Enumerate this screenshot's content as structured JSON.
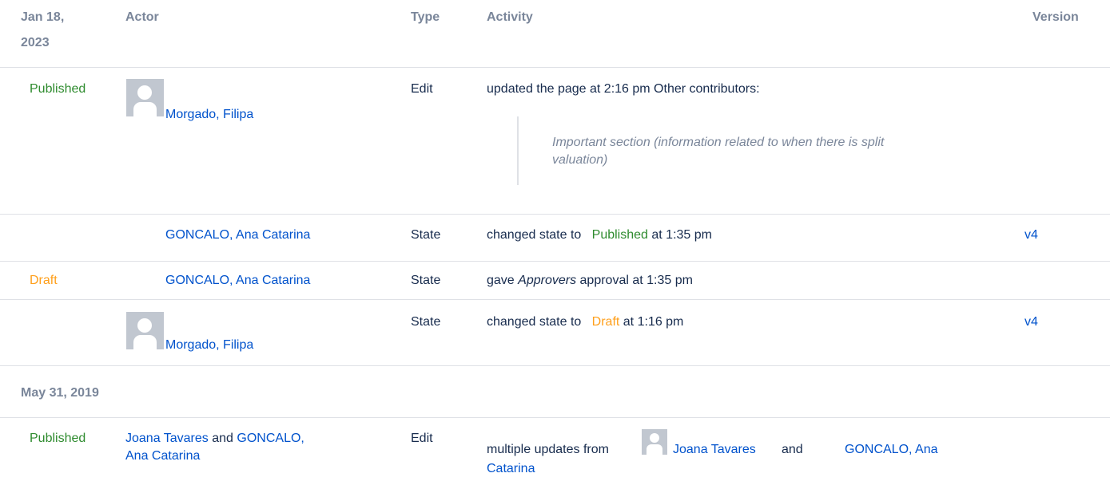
{
  "header": {
    "date": "Jan 18,",
    "date_year": "2023",
    "actor": "Actor",
    "type": "Type",
    "activity": "Activity",
    "version": "Version"
  },
  "rows": [
    {
      "status": "Published",
      "actor": "Morgado, Filipa",
      "type": "Edit",
      "activity": "updated the page at 2:16 pm Other contributors:",
      "quote": "Important section (information related to when there is split valuation)"
    },
    {
      "status": "",
      "actor": "GONCALO, Ana Catarina",
      "type": "State",
      "activity_prefix": "changed state to",
      "activity_state": "Published",
      "activity_suffix": "at 1:35 pm",
      "version": "v4"
    },
    {
      "status": "Draft",
      "actor": "GONCALO, Ana Catarina",
      "type": "State",
      "activity_prefix": "gave",
      "activity_italic": "Approvers",
      "activity_suffix": "approval at 1:35 pm"
    },
    {
      "status": "",
      "actor": "Morgado, Filipa",
      "type": "State",
      "activity_prefix": "changed state to",
      "activity_state": "Draft",
      "activity_suffix": "at 1:16 pm",
      "version": "v4"
    }
  ],
  "group2": {
    "date": "May 31, 2019",
    "row": {
      "status": "Published",
      "actor1": "Joana Tavares",
      "and": "and",
      "actor2_line1": "GONCALO,",
      "actor2_line2": "Ana Catarina",
      "type": "Edit",
      "activity_prefix": "multiple updates from",
      "activity_user1": "Joana Tavares",
      "activity_and": "and",
      "activity_user2_line1": "GONCALO, Ana",
      "activity_user2_line2": "Catarina"
    }
  },
  "colors": {
    "link": "#0052cc",
    "published": "#2e8b2e",
    "draft": "#ff9f1a",
    "header": "#7a869a"
  }
}
